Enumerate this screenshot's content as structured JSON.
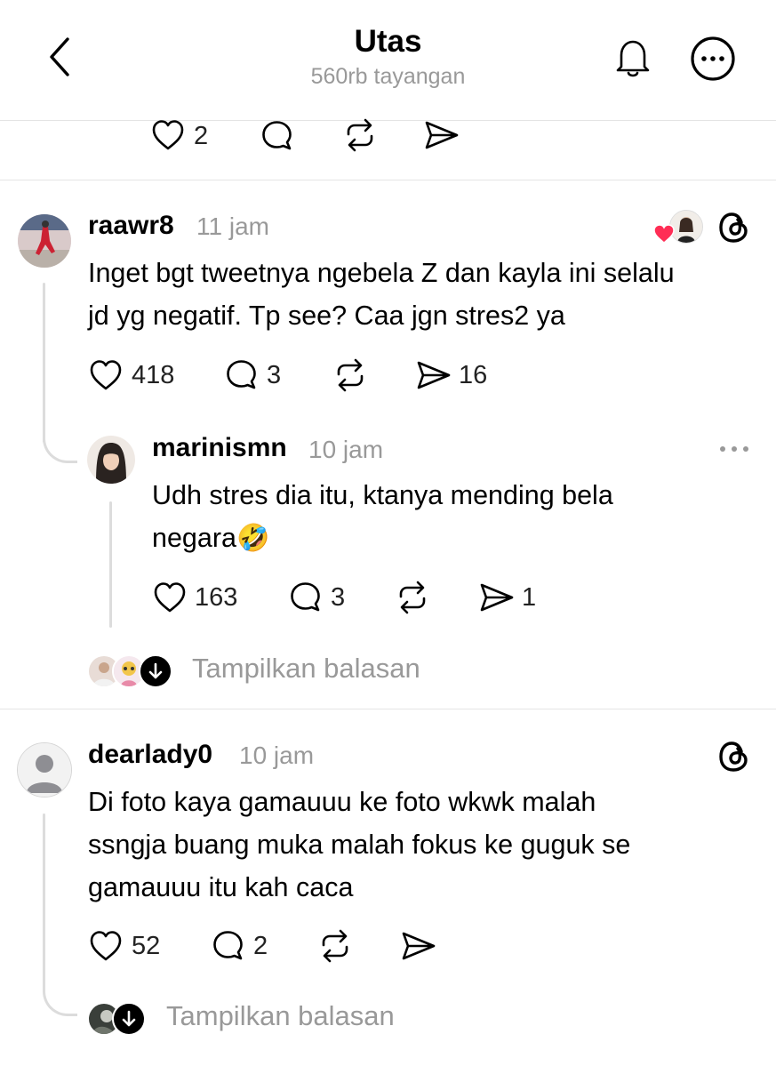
{
  "header": {
    "title": "Utas",
    "subtitle": "560rb tayangan"
  },
  "top_post_actions": {
    "likes": "2"
  },
  "posts": [
    {
      "username": "raawr8",
      "time": "11 jam",
      "text_line1": "Inget bgt tweetnya ngebela Z dan kayla ini selalu",
      "text_line2": "jd yg negatif. Tp see? Caa jgn stres2 ya",
      "likes": "418",
      "replies": "3",
      "shares": "16"
    },
    {
      "username": "marinismn",
      "time": "10 jam",
      "text_line1": "Udh stres dia itu, ktanya mending bela",
      "text_line2": "negara",
      "emoji": "🤣",
      "likes": "163",
      "replies": "3",
      "shares": "1"
    },
    {
      "username": "dearlady0",
      "time": "10 jam",
      "text_line1": "Di foto kaya gamauuu ke foto wkwk malah",
      "text_line2": "ssngja buang muka malah fokus ke guguk se",
      "text_line3": "gamauuu itu kah caca",
      "likes": "52",
      "replies": "2"
    }
  ],
  "show_replies_label": "Tampilkan balasan",
  "colors": {
    "heart_red": "#ff2d55",
    "muted_gray": "#999999",
    "divider": "#e4e4e4"
  },
  "icons": [
    "back-chevron-icon",
    "bell-icon",
    "more-circle-icon",
    "heart-icon",
    "comment-icon",
    "repost-icon",
    "share-icon",
    "threads-logo-icon",
    "arrow-down-icon"
  ]
}
